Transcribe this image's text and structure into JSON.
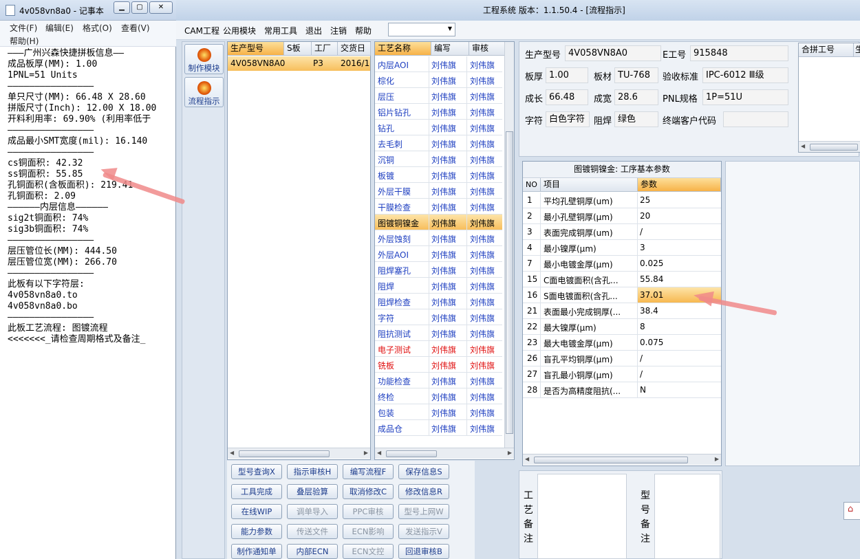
{
  "notepad": {
    "title": "4v058vn8a0 - 记事本",
    "menu": [
      "文件(F)",
      "编辑(E)",
      "格式(O)",
      "查看(V)",
      "帮助(H)"
    ],
    "lines": [
      "———广州兴森快捷拼板信息——",
      "成品板厚(MM): 1.00",
      "1PNL=51 Units",
      "————————————————",
      "单只尺寸(MM): 66.48 X 28.60",
      "拼版尺寸(Inch): 12.00 X 18.00",
      "开料利用率: 69.90% (利用率低于",
      "————————————————",
      "成品最小SMT宽度(mil): 16.140",
      "————————————————",
      "cs铜面积: 42.32",
      "ss铜面积: 55.85",
      "孔铜面积(含板面积): 219.41",
      "孔铜面积: 2.09",
      "——————内层信息——————",
      "sig2t铜面积: 74%",
      "sig3b铜面积: 74%",
      "————————————————",
      "层压管位长(MM): 444.50",
      "层压管位宽(MM): 266.70",
      "————————————————",
      "此板有以下字符层:",
      "4v058vn8a0.to",
      "4v058vn8a0.bo",
      "————————————————",
      "此板工艺流程: 图镀流程",
      "<<<<<<<_请检查周期格式及备注_"
    ]
  },
  "main": {
    "title": "工程系统  版本：1.1.50.4 - [流程指示]",
    "menu": [
      "CAM工程",
      "公用模块",
      "常用工具",
      "退出",
      "注销",
      "帮助"
    ],
    "nav": [
      "制作模块",
      "流程指示"
    ],
    "model_grid": {
      "headers": [
        "生产型号",
        "S板",
        "工厂",
        "交货日"
      ],
      "row": [
        "4V058VN8A0",
        "",
        "P3",
        "2016/1"
      ]
    },
    "process_grid": {
      "headers": [
        "工艺名称",
        "编写",
        "审核"
      ],
      "rows": [
        [
          "内层AOI",
          "刘伟旗",
          "刘伟旗"
        ],
        [
          "棕化",
          "刘伟旗",
          "刘伟旗"
        ],
        [
          "层压",
          "刘伟旗",
          "刘伟旗"
        ],
        [
          "铝片钻孔",
          "刘伟旗",
          "刘伟旗"
        ],
        [
          "钻孔",
          "刘伟旗",
          "刘伟旗"
        ],
        [
          "去毛刺",
          "刘伟旗",
          "刘伟旗"
        ],
        [
          "沉铜",
          "刘伟旗",
          "刘伟旗"
        ],
        [
          "板镀",
          "刘伟旗",
          "刘伟旗"
        ],
        [
          "外层干膜",
          "刘伟旗",
          "刘伟旗"
        ],
        [
          "干膜检查",
          "刘伟旗",
          "刘伟旗"
        ],
        [
          "图镀铜镍金",
          "刘伟旗",
          "刘伟旗"
        ],
        [
          "外层蚀刻",
          "刘伟旗",
          "刘伟旗"
        ],
        [
          "外层AOI",
          "刘伟旗",
          "刘伟旗"
        ],
        [
          "阻焊塞孔",
          "刘伟旗",
          "刘伟旗"
        ],
        [
          "阻焊",
          "刘伟旗",
          "刘伟旗"
        ],
        [
          "阻焊检查",
          "刘伟旗",
          "刘伟旗"
        ],
        [
          "字符",
          "刘伟旗",
          "刘伟旗"
        ],
        [
          "阻抗测试",
          "刘伟旗",
          "刘伟旗"
        ],
        [
          "电子测试",
          "刘伟旗",
          "刘伟旗"
        ],
        [
          "铣板",
          "刘伟旗",
          "刘伟旗"
        ],
        [
          "功能检查",
          "刘伟旗",
          "刘伟旗"
        ],
        [
          "终检",
          "刘伟旗",
          "刘伟旗"
        ],
        [
          "包装",
          "刘伟旗",
          "刘伟旗"
        ],
        [
          "成品仓",
          "刘伟旗",
          "刘伟旗"
        ]
      ],
      "selected_index": 10,
      "red_indices": [
        18,
        19
      ]
    },
    "info": {
      "model_label": "生产型号",
      "model": "4V058VN8A0",
      "e_label": "E工号",
      "e": "915848",
      "thick_label": "板厚",
      "thick": "1.00",
      "mat_label": "板材",
      "mat": "TU-768",
      "std_label": "验收标准",
      "std": "IPC-6012 Ⅲ级",
      "len_label": "成长",
      "len": "66.48",
      "wid_label": "成宽",
      "wid": "28.6",
      "pnl_label": "PNL规格",
      "pnl": "1P=51U",
      "char_label": "字符",
      "char": "白色字符",
      "mask_label": "阻焊",
      "mask": "绿色",
      "cust_label": "终端客户代码",
      "cust": ""
    },
    "hegong": {
      "header": "合拼工号",
      "header2": "生"
    },
    "params": {
      "title": "图镀铜镍金: 工序基本参数",
      "headers": [
        "NO",
        "项目",
        "参数"
      ],
      "rows": [
        [
          "1",
          "平均孔壁铜厚(um)",
          "25"
        ],
        [
          "2",
          "最小孔壁铜厚(μm)",
          "20"
        ],
        [
          "3",
          "表面完成铜厚(um)",
          "/"
        ],
        [
          "4",
          "最小镍厚(μm)",
          "3"
        ],
        [
          "7",
          "最小电镀金厚(μm)",
          "0.025"
        ],
        [
          "15",
          "C面电镀面积(含孔...",
          "55.84"
        ],
        [
          "16",
          "S面电镀面积(含孔...",
          "37.01"
        ],
        [
          "21",
          "表面最小完成铜厚(...",
          "38.4"
        ],
        [
          "22",
          "最大镍厚(μm)",
          "8"
        ],
        [
          "23",
          "最大电镀金厚(μm)",
          "0.075"
        ],
        [
          "26",
          "盲孔平均铜厚(μm)",
          "/"
        ],
        [
          "27",
          "盲孔最小铜厚(μm)",
          "/"
        ],
        [
          "28",
          "是否为高精度阻抗(...",
          "N"
        ]
      ],
      "selected_index": 6
    },
    "buttons": [
      [
        "型号查询X",
        "指示审核H",
        "编写流程F",
        "保存信息S"
      ],
      [
        "工具完成",
        "叠层验算",
        "取消修改C",
        "修改信息R"
      ],
      [
        "在线WIP",
        "调单导入",
        "PPC审核",
        "型号上网W"
      ],
      [
        "能力参数",
        "传送文件",
        "ECN影响",
        "发送指示V"
      ],
      [
        "制作通知单",
        "内部ECN",
        "ECN文控",
        "回退审核B"
      ]
    ],
    "disabled_buttons": [
      "调单导入",
      "PPC审核",
      "型号上网W",
      "传送文件",
      "ECN影响",
      "发送指示V",
      "ECN文控"
    ],
    "remarks": {
      "process_label": "工艺备注",
      "model_label": "型号备注"
    }
  },
  "colors": {
    "accent": "#f7be5c",
    "link": "#1d3ec0",
    "error": "#e01010",
    "arrow": "#f08a8a"
  }
}
